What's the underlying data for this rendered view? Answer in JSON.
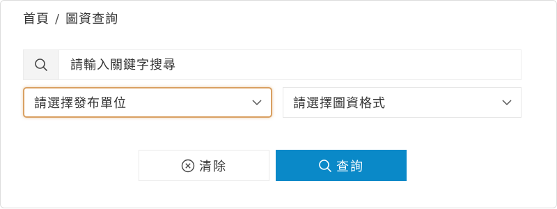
{
  "breadcrumb": {
    "home": "首頁",
    "separator": "/",
    "current": "圖資查詢"
  },
  "search": {
    "icon": "search-icon",
    "placeholder": "請輸入關鍵字搜尋",
    "value": ""
  },
  "filters": {
    "unit_select": {
      "selected": "請選擇發布單位",
      "icon": "chevron-down-icon",
      "focused": true
    },
    "format_select": {
      "selected": "請選擇圖資格式",
      "icon": "chevron-down-icon"
    }
  },
  "actions": {
    "clear_label": "清除",
    "clear_icon": "circle-x-icon",
    "search_label": "查詢",
    "search_icon": "search-icon"
  },
  "colors": {
    "primary": "#0a89c8",
    "focus_border": "#d9a062",
    "text": "#333333",
    "border": "#e6e6e6",
    "icon_box_bg": "#f4f4f4"
  }
}
